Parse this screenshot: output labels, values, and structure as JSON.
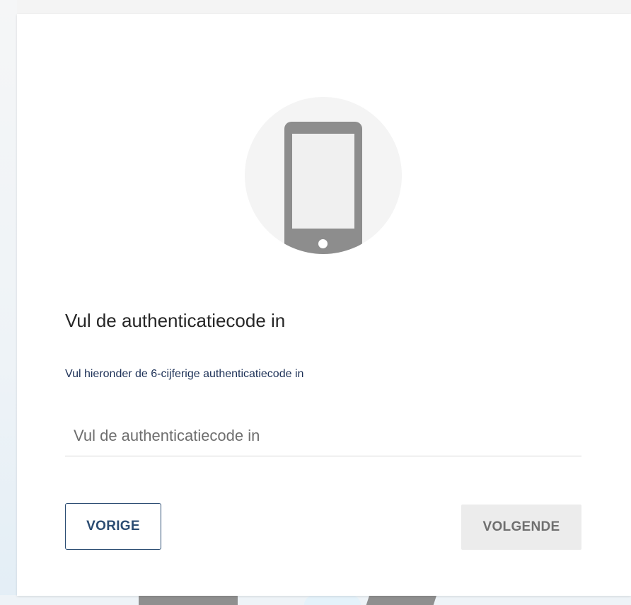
{
  "dialog": {
    "title": "Vul de authenticatiecode in",
    "subtitle": "Vul hieronder de 6-cijferige authenticatiecode in",
    "code_input": {
      "placeholder": "Vul de authenticatiecode in",
      "value": ""
    },
    "buttons": {
      "previous_label": "VORIGE",
      "next_label": "VOLGENDE"
    },
    "icon": "smartphone-icon"
  },
  "colors": {
    "accent": "#2c4d73",
    "subtitle_text": "#1d3157",
    "disabled_button_bg": "#ececec",
    "disabled_button_text": "#6f6f6f",
    "phone_icon": "#8d8d8d",
    "icon_circle": "#f4f4f4"
  }
}
